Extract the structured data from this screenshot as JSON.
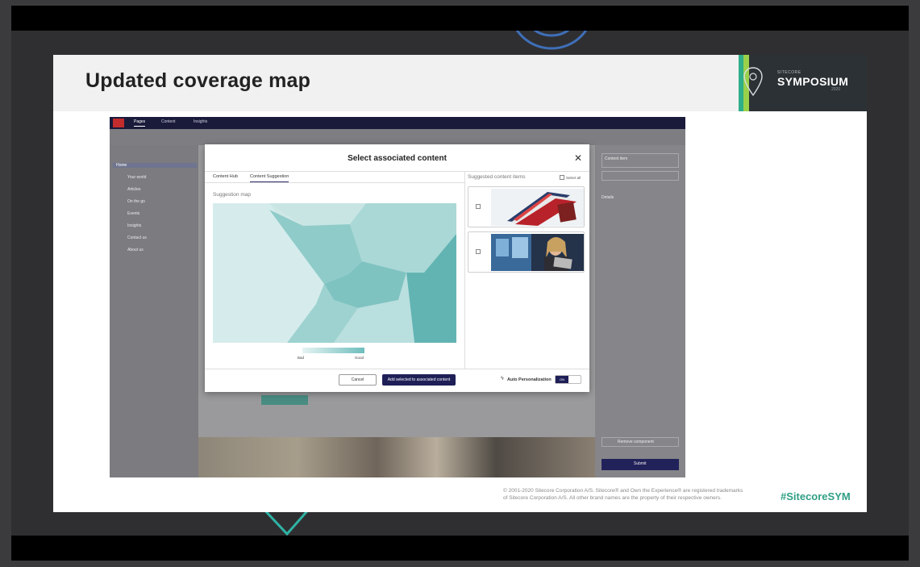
{
  "slide": {
    "title": "Updated coverage map",
    "brand_kicker": "SITECORE",
    "brand_name": "SYMPOSIUM",
    "brand_year": "2020",
    "legal_line1": "© 2001-2020 Sitecore Corporation A/S. Sitecore® and Own the Experience® are registered trademarks",
    "legal_line2": "of Sitecore Corporation A/S. All other brand names are the property of their respective owners.",
    "hashtag": "#SitecoreSYM"
  },
  "app": {
    "tabs": [
      "Pages",
      "Content",
      "Insights"
    ],
    "tree": [
      "Home",
      "Your world",
      "Articles",
      "On the go",
      "Events",
      "Insights",
      "Contact us",
      "About us"
    ],
    "right_panel": [
      "Content item",
      "Details",
      "Remove component",
      "Submit"
    ]
  },
  "modal": {
    "title": "Select associated content",
    "close_glyph": "✕",
    "tabs": [
      "Content Hub",
      "Content Suggestion"
    ],
    "active_tab": 1,
    "suggestion_map_label": "Suggestion map",
    "legend_low": "Bad",
    "legend_high": "Good",
    "suggested_items_label": "Suggested content items",
    "select_all_label": "Select all",
    "items": [
      {
        "image": "notebooks-photo",
        "checked": false
      },
      {
        "image": "woman-tablet-photo",
        "checked": false
      }
    ],
    "cancel_label": "Cancel",
    "add_label": "Add selected to associated content",
    "auto_personalization_label": "Auto Personalization",
    "toggle_label": "ON",
    "toggle_on": true
  },
  "colors": {
    "accent": "#1f1f58",
    "map_light": "#d8ecec",
    "map_dark": "#5fb3b2",
    "brand_teal": "#2f9f86"
  }
}
